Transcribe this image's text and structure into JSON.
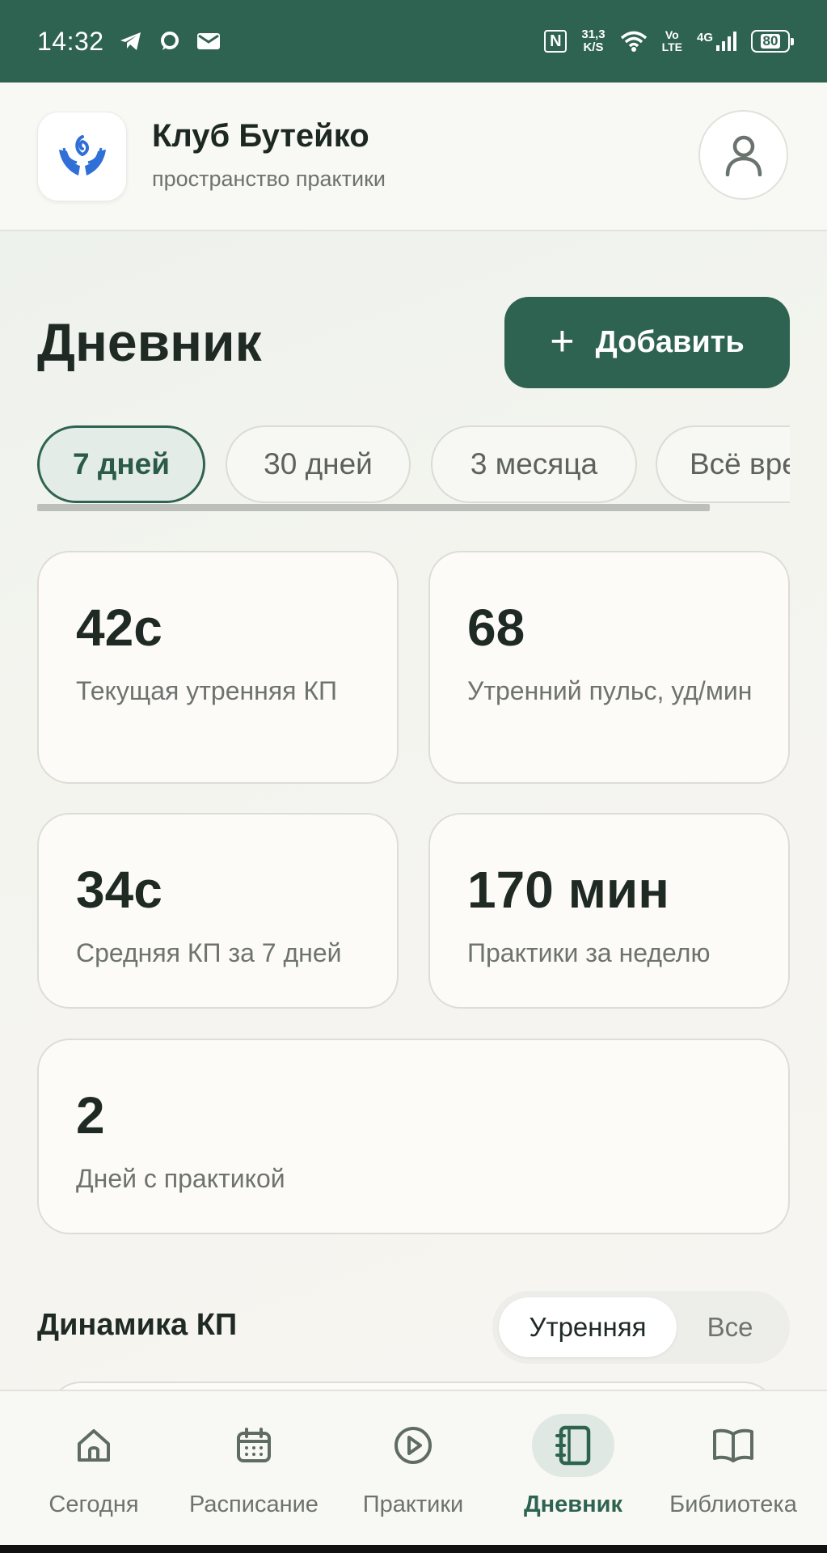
{
  "status_bar": {
    "time": "14:32",
    "left_icons": [
      "telegram-icon",
      "chat-bubble-icon",
      "mail-icon"
    ],
    "nfc": "N",
    "speed_value": "31,3",
    "speed_unit": "K/S",
    "volte_top": "Vo",
    "volte_bottom": "LTE",
    "network": "4G",
    "battery": "80"
  },
  "header": {
    "app_name": "Клуб Бутейко",
    "app_subtitle": "пространство практики",
    "logo_icon": "hands-logo-icon",
    "profile_icon": "user-icon"
  },
  "page": {
    "title": "Дневник",
    "add_button": "Добавить"
  },
  "filters": {
    "chips": [
      "7 дней",
      "30 дней",
      "3 месяца",
      "Всё время"
    ],
    "selected": "7 дней"
  },
  "stats": [
    {
      "value": "42с",
      "label": "Текущая утренняя КП"
    },
    {
      "value": "68",
      "label": "Утренний пульс, уд/мин"
    },
    {
      "value": "34с",
      "label": "Средняя КП за 7 дней"
    },
    {
      "value": "170 мин",
      "label": "Практики за неделю"
    },
    {
      "value": "2",
      "label": "Дней с практикой"
    }
  ],
  "dynamics": {
    "title": "Динамика КП",
    "options": [
      "Утренняя",
      "Все"
    ],
    "selected": "Утренняя"
  },
  "bottom_nav": {
    "items": [
      {
        "label": "Сегодня",
        "icon": "home-icon"
      },
      {
        "label": "Расписание",
        "icon": "calendar-icon"
      },
      {
        "label": "Практики",
        "icon": "play-circle-icon"
      },
      {
        "label": "Дневник",
        "icon": "notebook-icon"
      },
      {
        "label": "Библиотека",
        "icon": "book-open-icon"
      }
    ],
    "active": "Дневник"
  },
  "colors": {
    "primary": "#2f6351",
    "background": "#f6f5f1",
    "logo_blue": "#2f6fd6"
  }
}
